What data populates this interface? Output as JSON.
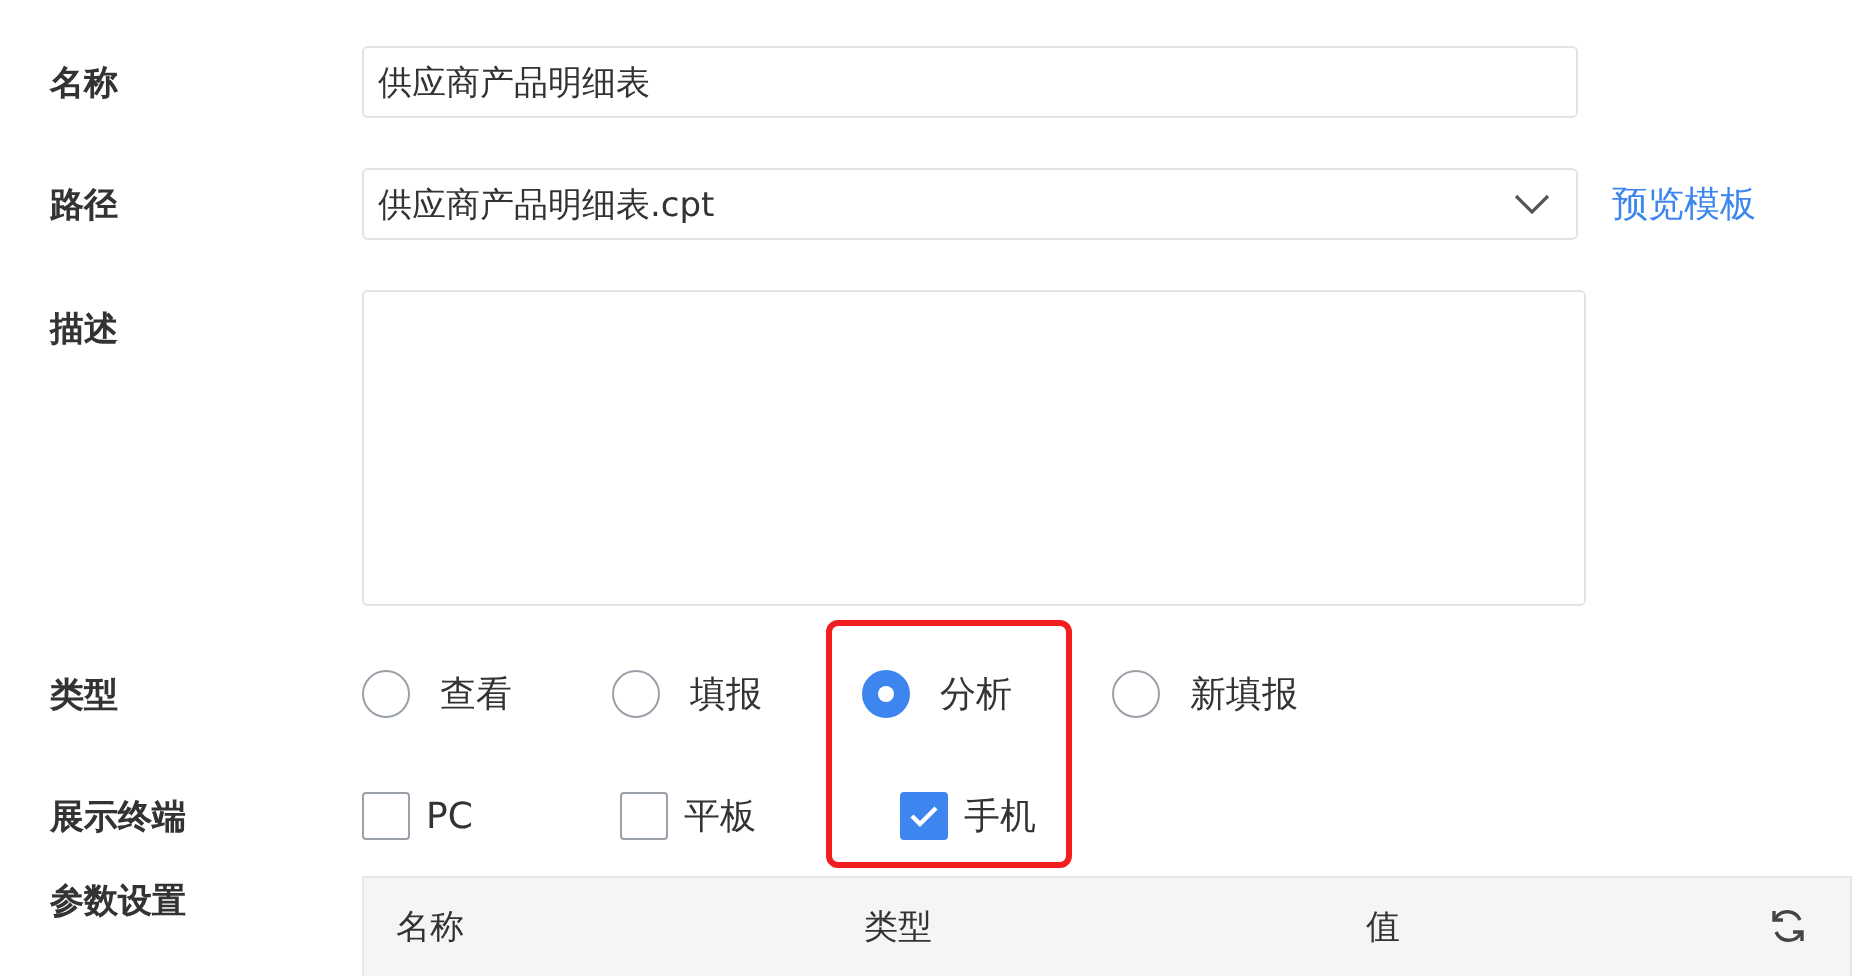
{
  "fields": [
    {
      "label": "名称",
      "kind": "text",
      "value": "供应商产品明细表"
    },
    {
      "label": "路径",
      "kind": "select",
      "value": "供应商产品明细表.cpt",
      "link": "预览模板"
    },
    {
      "label": "描述",
      "kind": "textarea"
    }
  ],
  "type": {
    "label": "类型",
    "options": [
      {
        "label": "查看",
        "selected": false
      },
      {
        "label": "填报",
        "selected": false
      },
      {
        "label": "分析",
        "selected": true
      },
      {
        "label": "新填报",
        "selected": false
      }
    ]
  },
  "terminals": {
    "label": "展示终端",
    "options": [
      {
        "label": "PC",
        "checked": false
      },
      {
        "label": "平板",
        "checked": false
      },
      {
        "label": "手机",
        "checked": true
      }
    ]
  },
  "params": {
    "label": "参数设置",
    "columns": [
      "名称",
      "类型",
      "值"
    ]
  }
}
